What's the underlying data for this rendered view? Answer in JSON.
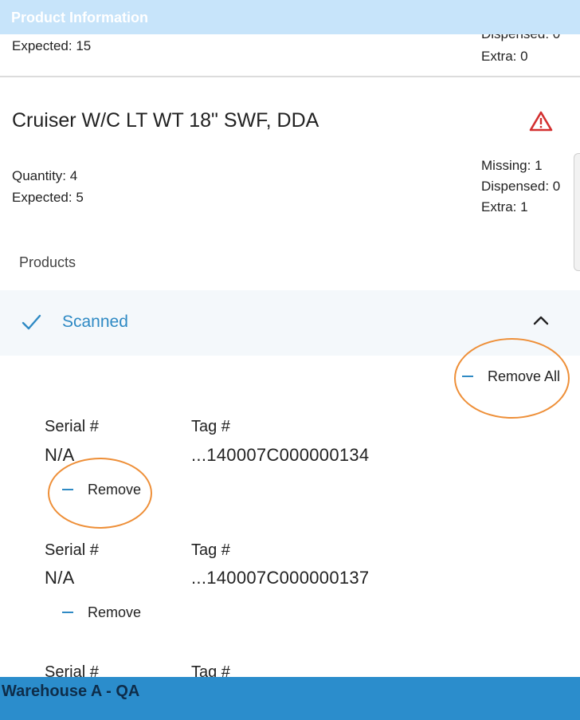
{
  "header": {
    "title": "Product Information"
  },
  "previous_item": {
    "expected": "Expected: 15",
    "dispensed_cut": "Dispensed: 0",
    "extra": "Extra: 0"
  },
  "item": {
    "name": "Cruiser W/C LT WT 18\" SWF, DDA",
    "warning_icon": "warning-triangle-icon",
    "quantity": "Quantity: 4",
    "expected": "Expected: 5",
    "missing": "Missing: 1",
    "dispensed": "Dispensed: 0",
    "extra": "Extra: 1"
  },
  "products": {
    "label": "Products",
    "scanned_label": "Scanned",
    "remove_all_label": "Remove All",
    "serial_header": "Serial #",
    "tag_header": "Tag #",
    "remove_label": "Remove",
    "rows": [
      {
        "serial": "N/A",
        "tag": "...140007C000000134"
      },
      {
        "serial": "N/A",
        "tag": "...140007C000000137"
      }
    ]
  },
  "footer": {
    "location": "Warehouse A - QA"
  },
  "colors": {
    "accent": "#2f8ac4",
    "highlight_ring": "#ee8f38",
    "warning": "#d32f2f",
    "footer_bg": "#2b8dcc",
    "header_bg": "#c7e4fa"
  }
}
